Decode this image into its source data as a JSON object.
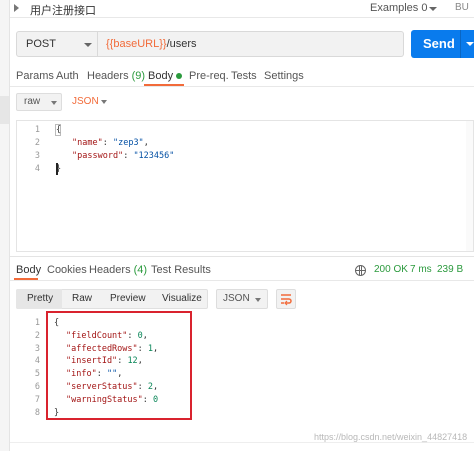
{
  "request": {
    "title": "用户注册接口",
    "examples_label": "Examples",
    "examples_count": "0",
    "top_right_fragment": "BU"
  },
  "url_bar": {
    "method": "POST",
    "url_variable": "{{baseURL}}",
    "url_path": "/users",
    "send_label": "Send"
  },
  "request_tabs": [
    {
      "label": "Params"
    },
    {
      "label": "Auth"
    },
    {
      "label": "Headers",
      "count": "(9)"
    },
    {
      "label": "Body",
      "active": true
    },
    {
      "label": "Pre-req."
    },
    {
      "label": "Tests"
    },
    {
      "label": "Settings"
    }
  ],
  "body_mode": {
    "type": "raw",
    "format": "JSON"
  },
  "request_body": {
    "lines": [
      {
        "no": "1",
        "text": "{"
      },
      {
        "no": "2",
        "key": "\"name\"",
        "value": "\"zep3\"",
        "sep": ": ",
        "tail": ","
      },
      {
        "no": "3",
        "key": "\"password\"",
        "value": "\"123456\"",
        "sep": ": ",
        "tail": ""
      },
      {
        "no": "4",
        "text": "}"
      }
    ]
  },
  "response_tabs": [
    {
      "label": "Body",
      "active": true
    },
    {
      "label": "Cookies"
    },
    {
      "label": "Headers",
      "count": "(4)"
    },
    {
      "label": "Test Results"
    }
  ],
  "response_status": {
    "status": "200 OK",
    "time": "7 ms",
    "size": "239 B"
  },
  "response_view": {
    "modes": [
      "Pretty",
      "Raw",
      "Preview",
      "Visualize"
    ],
    "active_mode": "Pretty",
    "format": "JSON"
  },
  "response_body": {
    "lines": [
      {
        "no": "1",
        "text": "{"
      },
      {
        "no": "2",
        "key": "\"fieldCount\"",
        "value": "0",
        "tail": ","
      },
      {
        "no": "3",
        "key": "\"affectedRows\"",
        "value": "1",
        "tail": ","
      },
      {
        "no": "4",
        "key": "\"insertId\"",
        "value": "12",
        "tail": ","
      },
      {
        "no": "5",
        "key": "\"info\"",
        "value": "\"\"",
        "tail": ","
      },
      {
        "no": "6",
        "key": "\"serverStatus\"",
        "value": "2",
        "tail": ","
      },
      {
        "no": "7",
        "key": "\"warningStatus\"",
        "value": "0",
        "tail": ""
      },
      {
        "no": "8",
        "text": "}"
      }
    ]
  },
  "watermark": "https://blog.csdn.net/weixin_44827418",
  "colors": {
    "accent": "#f26b3a",
    "send": "#097bed",
    "status_ok": "#2b9a3d",
    "json_key": "#a31515",
    "json_string": "#0451a5",
    "json_number": "#098658",
    "highlight": "#d9232e"
  }
}
